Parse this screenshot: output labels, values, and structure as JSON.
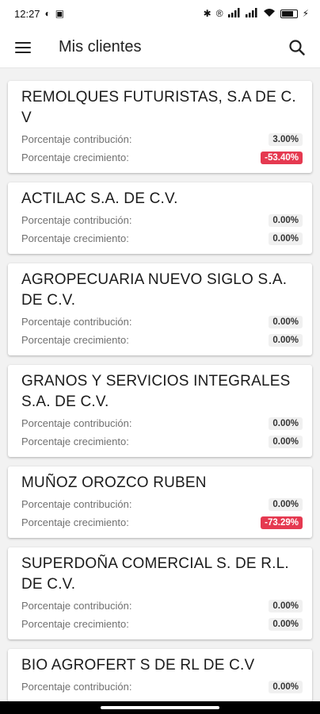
{
  "status_bar": {
    "time": "12:27",
    "battery_icon": "battery-charging-icon"
  },
  "app_bar": {
    "title": "Mis clientes",
    "menu_icon": "hamburger-menu-icon",
    "search_icon": "search-icon"
  },
  "labels": {
    "contribution": "Porcentaje contribución:",
    "growth": "Porcentaje crecimiento:"
  },
  "colors": {
    "negative_badge": "#e53950",
    "neutral_badge": "#f0f0f0"
  },
  "clients": [
    {
      "name": "REMOLQUES FUTURISTAS, S.A DE C. V",
      "contribution": "3.00%",
      "growth": "-53.40%",
      "growth_negative": true
    },
    {
      "name": "ACTILAC S.A. DE C.V.",
      "contribution": "0.00%",
      "growth": "0.00%",
      "growth_negative": false
    },
    {
      "name": "AGROPECUARIA NUEVO SIGLO S.A. DE C.V.",
      "contribution": "0.00%",
      "growth": "0.00%",
      "growth_negative": false
    },
    {
      "name": "GRANOS Y SERVICIOS INTEGRALES S.A. DE C.V.",
      "contribution": "0.00%",
      "growth": "0.00%",
      "growth_negative": false
    },
    {
      "name": "MUÑOZ OROZCO RUBEN",
      "contribution": "0.00%",
      "growth": "-73.29%",
      "growth_negative": true
    },
    {
      "name": "SUPERDOÑA COMERCIAL S. DE R.L. DE C.V.",
      "contribution": "0.00%",
      "growth": "0.00%",
      "growth_negative": false
    },
    {
      "name": "BIO AGROFERT S DE RL DE C.V",
      "contribution": "0.00%",
      "growth": "",
      "growth_negative": false
    }
  ]
}
